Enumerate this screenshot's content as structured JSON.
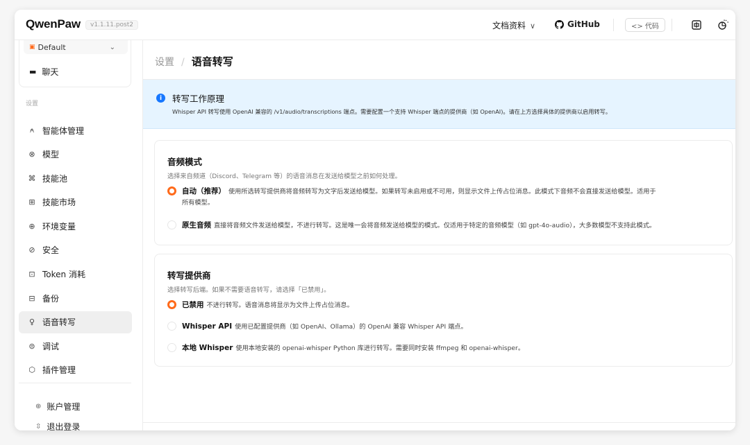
{
  "app": {
    "logo": "QwenPaw",
    "version": "v1.1.11.post2"
  },
  "topnav": {
    "docs_label": "文档资料",
    "github_label": "GitHub",
    "code_label": "<> 代码"
  },
  "sidebar": {
    "agent_select": "Default",
    "chat_label": "聊天",
    "section_label": "设置",
    "items": [
      {
        "label": "智能体管理",
        "icon": "agent-icon"
      },
      {
        "label": "模型",
        "icon": "model-icon"
      },
      {
        "label": "技能池",
        "icon": "skill-pool-icon"
      },
      {
        "label": "技能市场",
        "icon": "skill-market-icon"
      },
      {
        "label": "环境变量",
        "icon": "env-icon"
      },
      {
        "label": "安全",
        "icon": "security-icon"
      },
      {
        "label": "Token 消耗",
        "icon": "token-icon"
      },
      {
        "label": "备份",
        "icon": "backup-icon"
      },
      {
        "label": "语音转写",
        "icon": "microphone-icon"
      },
      {
        "label": "调试",
        "icon": "debug-icon"
      },
      {
        "label": "插件管理",
        "icon": "plugin-icon"
      }
    ],
    "active_index": 8,
    "account_label": "账户管理",
    "logout_label": "退出登录"
  },
  "main": {
    "breadcrumb_parent": "设置",
    "breadcrumb_current": "语音转写",
    "info": {
      "title": "转写工作原理",
      "desc": "Whisper API 转写使用 OpenAI 兼容的 /v1/audio/transcriptions 端点。需要配置一个支持 Whisper 端点的提供商（如 OpenAI)。请在上方选择具体的提供商以启用转写。"
    },
    "audio_mode": {
      "title": "音频模式",
      "subtitle": "选择来自频道（Discord、Telegram 等）的语音消息在发送给模型之前如何处理。",
      "options": [
        {
          "label": "自动（推荐）",
          "desc_line1": "使用所选转写提供商将音频转写为文字后发送给模型。如果转写未启用或不可用，则显示文件上传占位消息。此模式下音频不会直接发送给模型。适用于",
          "desc_line2": "所有模型。",
          "selected": true
        },
        {
          "label": "原生音频",
          "desc_line1": "直接将音频文件发送给模型，不进行转写。这是唯一会将音频发送给模型的模式。仅适用于特定的音频模型（如 gpt-4o-audio），大多数模型不支持此模式。",
          "desc_line2": "",
          "selected": false
        }
      ]
    },
    "provider": {
      "title": "转写提供商",
      "subtitle": "选择转写后端。如果不需要语音转写，请选择「已禁用」。",
      "options": [
        {
          "label": "已禁用",
          "desc": "不进行转写。语音消息将显示为文件上传占位消息。",
          "selected": true
        },
        {
          "label": "Whisper API",
          "desc": "使用已配置提供商（如 OpenAI、Ollama）的 OpenAI 兼容 Whisper API 端点。",
          "selected": false
        },
        {
          "label": "本地 Whisper",
          "desc": "使用本地安装的 openai-whisper Python 库进行转写。需要同时安装 ffmpeg 和 openai-whisper。",
          "selected": false
        }
      ]
    }
  },
  "colors": {
    "accent": "#ff6a1a",
    "info_bg": "#e6f4ff",
    "info_icon": "#1677ff",
    "active_bg": "#efefef"
  }
}
